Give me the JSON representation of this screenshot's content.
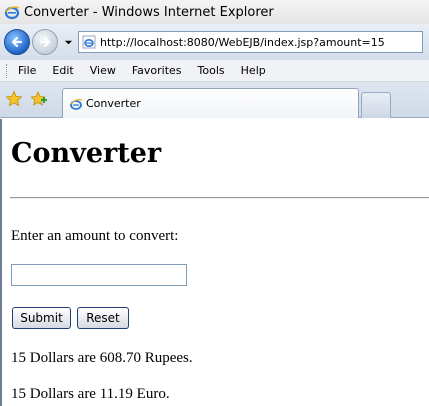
{
  "window": {
    "title": "Converter - Windows Internet Explorer"
  },
  "address_bar": {
    "url": "http://localhost:8080/WebEJB/index.jsp?amount=15"
  },
  "menu": {
    "items": [
      "File",
      "Edit",
      "View",
      "Favorites",
      "Tools",
      "Help"
    ]
  },
  "tabs": [
    {
      "label": "Converter"
    }
  ],
  "page": {
    "heading": "Converter",
    "prompt": "Enter an amount to convert:",
    "amount_value": "",
    "submit_label": "Submit",
    "reset_label": "Reset",
    "results": [
      "15 Dollars are 608.70 Rupees.",
      "15 Dollars are 11.19 Euro."
    ]
  },
  "icons": {
    "browser": "ie-icon",
    "back": "back-arrow-icon",
    "forward": "forward-arrow-icon",
    "favorites": "star-icon",
    "add_favorites": "add-favorite-icon"
  },
  "colors": {
    "accent": "#1f63c8",
    "input_border": "#7f9db9",
    "button_border": "#1e3f73"
  }
}
